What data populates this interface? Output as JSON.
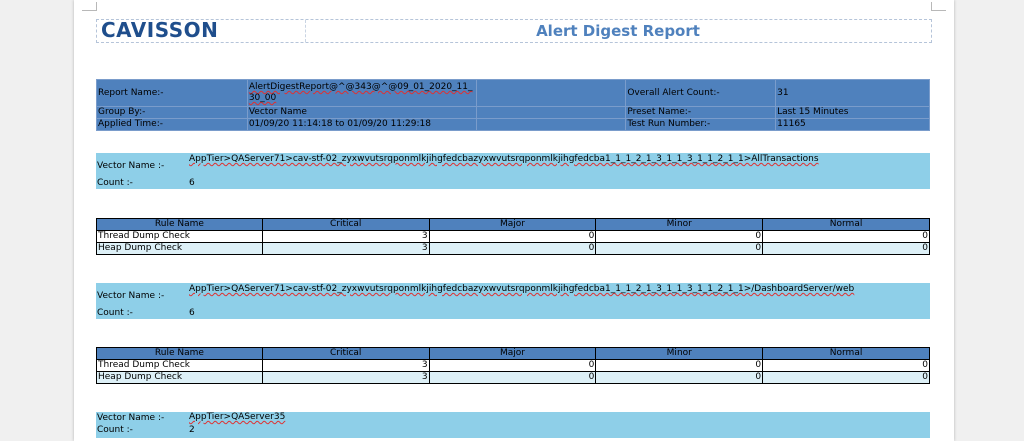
{
  "header": {
    "logo": "CAVISSON",
    "title": "Alert Digest Report"
  },
  "info": {
    "report_name_label": "Report Name:-",
    "report_name": "AlertDigestReport@^@343@^@09_01_2020_11_30_00",
    "overall_alert_count_label": "Overall Alert Count:-",
    "overall_alert_count": "31",
    "group_by_label": "Group By:-",
    "group_by": "Vector Name",
    "preset_name_label": "Preset Name:-",
    "preset_name": "Last 15 Minutes",
    "applied_time_label": "Applied Time:-",
    "applied_time": "01/09/20 11:14:18 to 01/09/20 11:29:18",
    "test_run_number_label": "Test Run Number:-",
    "test_run_number": "11165"
  },
  "rule_table_headers": [
    "Rule Name",
    "Critical",
    "Major",
    "Minor",
    "Normal"
  ],
  "vectors": [
    {
      "label": "Vector Name :-",
      "value": "AppTier>QAServer71>cav-stf-02_zyxwvutsrqponmlkjihgfedcbazyxwvutsrqponmlkjihgfedcba1_1_1_2_1_3_1_1_3_1_1_2_1_1>AllTransactions",
      "count_label": "Count :-",
      "count": "6",
      "rules": [
        {
          "name": "Thread Dump Check",
          "critical": "3",
          "major": "0",
          "minor": "0",
          "normal": "0"
        },
        {
          "name": "Heap Dump Check",
          "critical": "3",
          "major": "0",
          "minor": "0",
          "normal": "0"
        }
      ]
    },
    {
      "label": "Vector Name :-",
      "value": "AppTier>QAServer71>cav-stf-02_zyxwvutsrqponmlkjihgfedcbazyxwvutsrqponmlkjihgfedcba1_1_1_2_1_3_1_1_3_1_1_2_1_1>/DashboardServer/web",
      "count_label": "Count :-",
      "count": "6",
      "rules": [
        {
          "name": "Thread Dump Check",
          "critical": "3",
          "major": "0",
          "minor": "0",
          "normal": "0"
        },
        {
          "name": "Heap Dump Check",
          "critical": "3",
          "major": "0",
          "minor": "0",
          "normal": "0"
        }
      ]
    },
    {
      "label": "Vector Name :-",
      "value": "AppTier>QAServer35",
      "count_label": "Count :-",
      "count": "2"
    }
  ],
  "colors": {
    "header_blue": "#4f81bd",
    "vector_band": "#8ecfe8",
    "row_alt": "#ddf0f7",
    "logo": "#1f4e8c"
  }
}
